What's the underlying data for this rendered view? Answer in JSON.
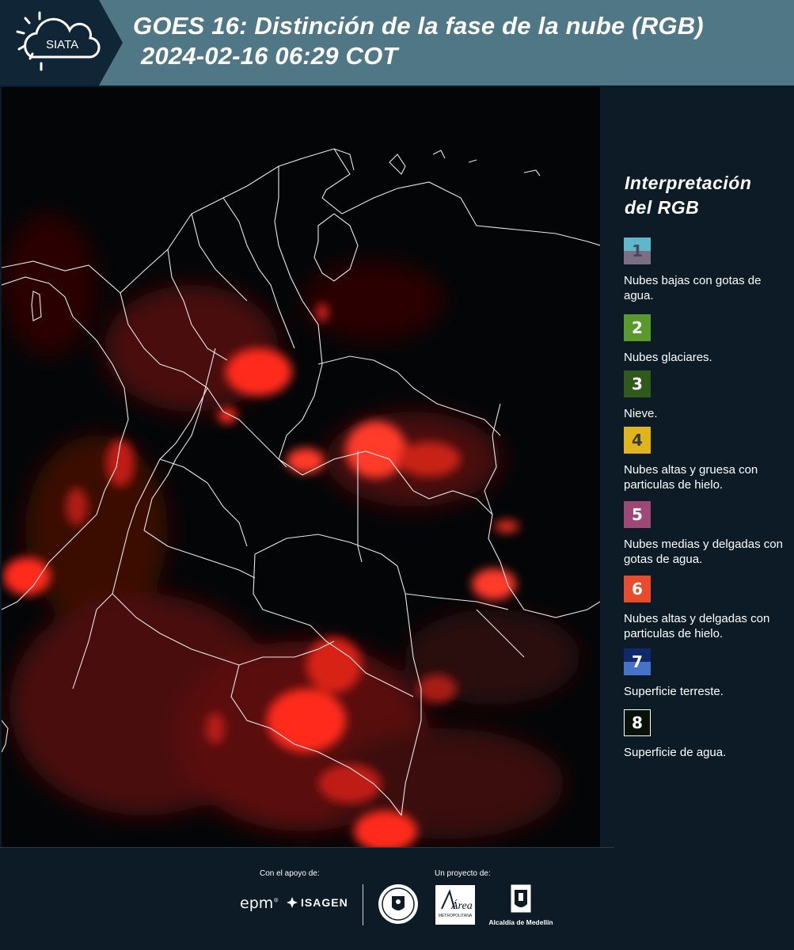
{
  "header": {
    "logo_text": "SIATA",
    "title_line1": "GOES 16: Distinción de la fase de la nube (RGB)",
    "title_line2": "2024-02-16 06:29 COT",
    "bg_color": "#4f7786"
  },
  "legend": {
    "title_line1": "Interpretación",
    "title_line2": "del RGB",
    "items": [
      {
        "number": "1",
        "label": "Nubes bajas con gotas de agua.",
        "colors": [
          "#5eb8c9",
          "#7b6f86"
        ]
      },
      {
        "number": "2",
        "label": "Nubes glaciares.",
        "colors": [
          "#5a9a2c"
        ]
      },
      {
        "number": "3",
        "label": "Nieve.",
        "colors": [
          "#2f5a1c"
        ]
      },
      {
        "number": "4",
        "label": "Nubes altas y gruesa con particulas de hielo.",
        "colors": [
          "#e0b41c"
        ]
      },
      {
        "number": "5",
        "label": "Nubes medias y delgadas con gotas de agua.",
        "colors": [
          "#9e4878"
        ]
      },
      {
        "number": "6",
        "label": "Nubes altas y delgadas con particulas de hielo.",
        "colors": [
          "#e84c2c"
        ]
      },
      {
        "number": "7",
        "label": "Superficie terreste.",
        "colors": [
          "#0e2a6b",
          "#4673c8"
        ]
      },
      {
        "number": "8",
        "label": "Superficie de agua.",
        "colors": [
          "#081208"
        ]
      }
    ]
  },
  "footer": {
    "support_label": "Con el apoyo de:",
    "project_label": "Un proyecto de:",
    "sponsors": [
      "epm",
      "ISAGEN"
    ],
    "partners": [
      "Área Metropolitana Valle de Aburrá",
      "Alcaldía de Medellín"
    ],
    "area_text": "Área",
    "area_sub": "METROPOLITANA",
    "alcaldia_text": "Alcaldía de Medellín"
  }
}
